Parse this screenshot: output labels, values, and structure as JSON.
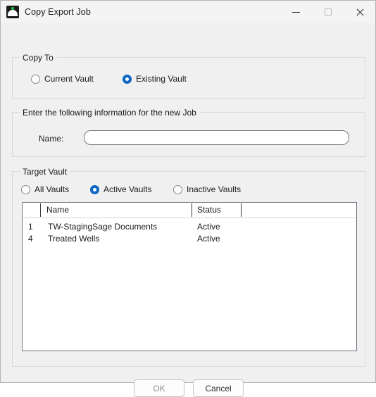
{
  "window": {
    "title": "Copy Export Job",
    "icon": "app-icon",
    "controls": {
      "minimize": "minimize-icon",
      "maximize": "maximize-icon",
      "close": "close-icon"
    },
    "background": "#f0f0f0",
    "accent": "#0d68c6"
  },
  "copy_to": {
    "legend": "Copy To",
    "options": [
      {
        "label": "Current Vault",
        "selected": false
      },
      {
        "label": "Existing Vault",
        "selected": true
      }
    ]
  },
  "new_job": {
    "legend": "Enter the following information for the new Job",
    "name_label": "Name:",
    "name_value": "",
    "name_placeholder": ""
  },
  "target_vault": {
    "legend": "Target Vault",
    "options": [
      {
        "label": "All Vaults",
        "selected": false
      },
      {
        "label": "Active Vaults",
        "selected": true
      },
      {
        "label": "Inactive Vaults",
        "selected": false
      }
    ],
    "table": {
      "columns": [
        "",
        "Name",
        "Status",
        ""
      ],
      "rows": [
        {
          "index": "1",
          "name": "TW-StagingSage Documents",
          "status": "Active"
        },
        {
          "index": "4",
          "name": "Treated Wells",
          "status": "Active"
        }
      ]
    }
  },
  "footer": {
    "ok_label": "OK",
    "ok_enabled": false,
    "cancel_label": "Cancel",
    "cancel_enabled": true
  }
}
